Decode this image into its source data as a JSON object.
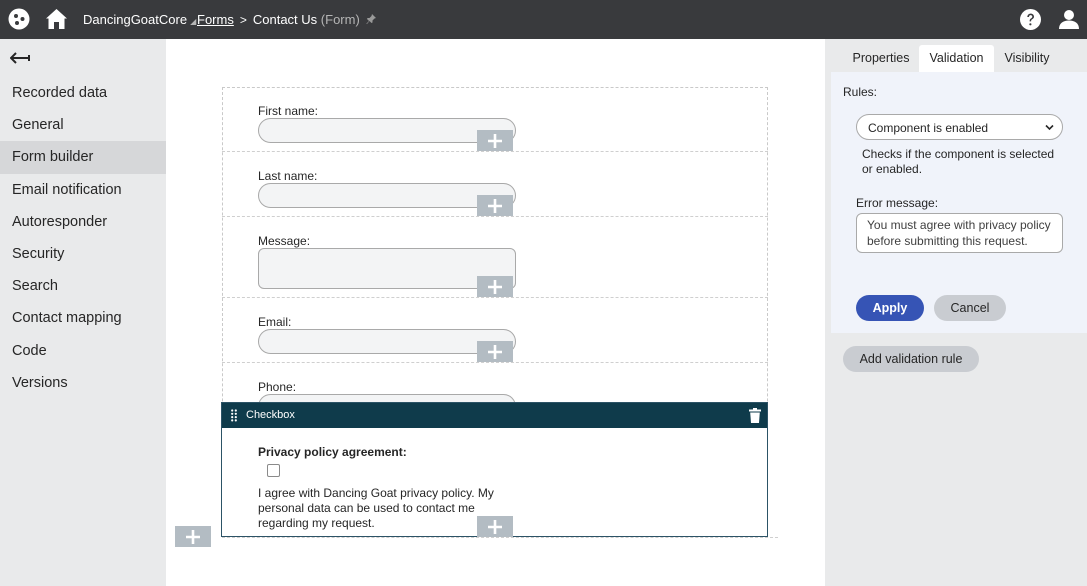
{
  "topbar": {
    "site_name": "DancingGoatCore",
    "site_dropdown_glyph": "◢",
    "breadcrumb_link": "Forms",
    "breadcrumb_separator": ">",
    "breadcrumb_current": "Contact Us",
    "breadcrumb_kind": "(Form)",
    "icons": [
      "kentico-logo-icon",
      "home-icon",
      "pin-icon",
      "help-icon",
      "user-icon"
    ]
  },
  "sidebar": {
    "back_icon": "arrow-left-icon",
    "items": [
      {
        "label": "Recorded data",
        "active": false
      },
      {
        "label": "General",
        "active": false
      },
      {
        "label": "Form builder",
        "active": true
      },
      {
        "label": "Email notification",
        "active": false
      },
      {
        "label": "Autoresponder",
        "active": false
      },
      {
        "label": "Security",
        "active": false
      },
      {
        "label": "Search",
        "active": false
      },
      {
        "label": "Contact mapping",
        "active": false
      },
      {
        "label": "Code",
        "active": false
      },
      {
        "label": "Versions",
        "active": false
      }
    ]
  },
  "form": {
    "fields": [
      {
        "label": "First name:",
        "type": "text"
      },
      {
        "label": "Last name:",
        "type": "text"
      },
      {
        "label": "Message:",
        "type": "textarea"
      },
      {
        "label": "Email:",
        "type": "text"
      },
      {
        "label": "Phone:",
        "type": "text"
      }
    ],
    "checkbox_widget": {
      "header_title": "Checkbox",
      "label": "Privacy policy agreement:",
      "checked": false,
      "text": "I agree with Dancing Goat privacy policy. My personal data can be used to contact me regarding my request."
    }
  },
  "right_panel": {
    "tabs": [
      {
        "label": "Properties",
        "active": false
      },
      {
        "label": "Validation",
        "active": true
      },
      {
        "label": "Visibility",
        "active": false
      }
    ],
    "rules_title": "Rules:",
    "rule_select_value": "Component is enabled",
    "rule_description": "Checks if the component is selected or enabled.",
    "error_label": "Error message:",
    "error_message": "You must agree with privacy policy before submitting this request.",
    "apply_label": "Apply",
    "cancel_label": "Cancel",
    "add_rule_label": "Add validation rule"
  },
  "colors": {
    "topbar_bg": "#393a3d",
    "sidebar_bg": "#e9eaeb",
    "widget_header_bg": "#0f3b4b",
    "apply_button_bg": "#3654b5"
  }
}
